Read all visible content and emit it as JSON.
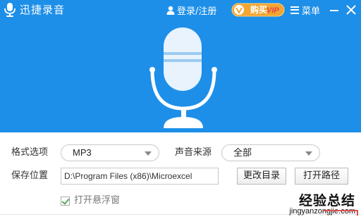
{
  "app": {
    "title": "迅捷录音"
  },
  "header": {
    "login_label": "登录/注册",
    "vip_label": "购买",
    "vip_text": "VIP",
    "menu_label": "菜单"
  },
  "settings": {
    "format_label": "格式选项",
    "format_value": "MP3",
    "source_label": "声音来源",
    "source_value": "全部",
    "save_label": "保存位置",
    "save_path": "D:\\Program Files (x86)\\Microexcel",
    "change_dir_button": "更改目录",
    "open_path_button": "打开路径",
    "float_window_label": "打开悬浮窗",
    "float_window_checked": true
  },
  "watermark": {
    "big_text": "经验总结",
    "site": "jingyanzongjie.com"
  },
  "colors": {
    "accent": "#1d8fe8",
    "vip_gold": "#f2a531"
  }
}
